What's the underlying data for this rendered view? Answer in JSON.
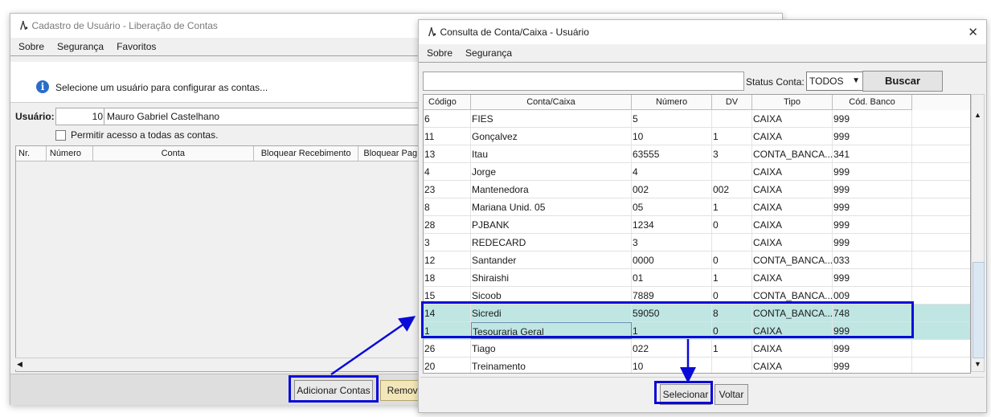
{
  "left_window": {
    "title": "Cadastro de Usuário - Liberação de Contas",
    "menu": [
      "Sobre",
      "Segurança",
      "Favoritos"
    ],
    "info_text": "Selecione um usuário para configurar as contas...",
    "usuario_label": "Usuário:",
    "usuario_id": "10",
    "usuario_name": "Mauro Gabriel Castelhano",
    "permitir_label": "Permitir acesso a todas as contas.",
    "columns": [
      "Nr.",
      "Número",
      "Conta",
      "Bloquear Recebimento",
      "Bloquear Pag"
    ],
    "buttons": {
      "add": "Adicionar Contas",
      "remove": "Remove"
    }
  },
  "right_window": {
    "title": "Consulta de Conta/Caixa - Usuário",
    "close": "✕",
    "menu": [
      "Sobre",
      "Segurança"
    ],
    "search_value": "",
    "status_label": "Status Conta:",
    "status_value": "TODOS",
    "buscar": "Buscar",
    "columns": [
      "Código",
      "Conta/Caixa",
      "Número",
      "DV",
      "Tipo",
      "Cód. Banco"
    ],
    "rows": [
      [
        "6",
        "FIES",
        "5",
        "",
        "CAIXA",
        "999"
      ],
      [
        "11",
        "Gonçalvez",
        "10",
        "1",
        "CAIXA",
        "999"
      ],
      [
        "13",
        "Itau",
        "63555",
        "3",
        "CONTA_BANCA...",
        "341"
      ],
      [
        "4",
        "Jorge",
        "4",
        "",
        "CAIXA",
        "999"
      ],
      [
        "23",
        "Mantenedora",
        "002",
        "002",
        "CAIXA",
        "999"
      ],
      [
        "8",
        "Mariana Unid. 05",
        "05",
        "1",
        "CAIXA",
        "999"
      ],
      [
        "28",
        "PJBANK",
        "1234",
        "0",
        "CAIXA",
        "999"
      ],
      [
        "3",
        "REDECARD",
        "3",
        "",
        "CAIXA",
        "999"
      ],
      [
        "12",
        "Santander",
        "0000",
        "0",
        "CONTA_BANCA...",
        "033"
      ],
      [
        "18",
        "Shiraishi",
        "01",
        "1",
        "CAIXA",
        "999"
      ],
      [
        "15",
        "Sicoob",
        "7889",
        "0",
        "CONTA_BANCA...",
        "009"
      ],
      [
        "14",
        "Sicredi",
        "59050",
        "8",
        "CONTA_BANCA...",
        "748"
      ],
      [
        "1",
        "Tesouraria Geral",
        "1",
        "0",
        "CAIXA",
        "999"
      ],
      [
        "26",
        "Tiago",
        "022",
        "1",
        "CAIXA",
        "999"
      ],
      [
        "20",
        "Treinamento",
        "10",
        "",
        "CAIXA",
        "999"
      ]
    ],
    "selected_rows": [
      11,
      12
    ],
    "buttons": {
      "selecionar": "Selecionar",
      "voltar": "Voltar"
    }
  },
  "colors": {
    "selection": "#bfe6e3",
    "annotation": "#0a0ad8"
  }
}
